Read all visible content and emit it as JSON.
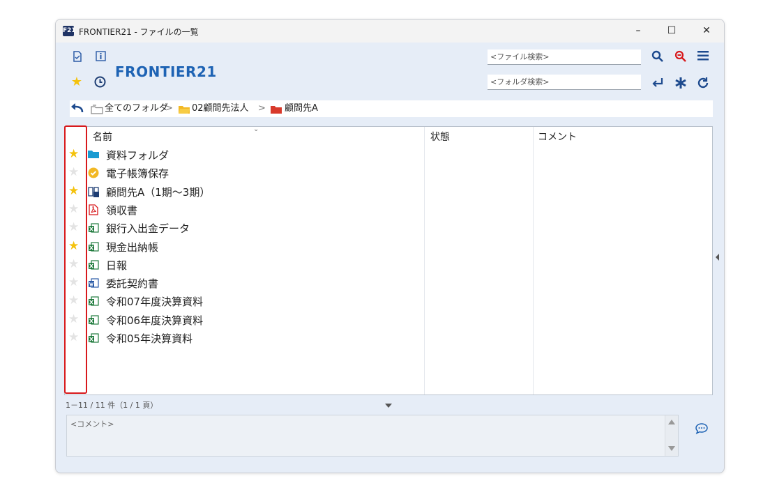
{
  "window": {
    "app_icon_text": "F21",
    "title": "FRONTIER21 - ファイルの一覧",
    "minimize_glyph": "–",
    "maximize_glyph": "☐",
    "close_glyph": "✕"
  },
  "toolbar": {
    "brand": "FRONTIER21",
    "file_search_placeholder": "<ファイル検索>",
    "folder_search_placeholder": "<フォルダ検索>"
  },
  "breadcrumb": {
    "items": [
      "全てのフォルダ",
      "02顧問先法人",
      "顧問先A"
    ],
    "separator": ">"
  },
  "columns": [
    "名前",
    "状態",
    "コメント"
  ],
  "files": [
    {
      "name": "資料フォルダ",
      "starred": true,
      "icon": "folder-icon"
    },
    {
      "name": "電子帳簿保存",
      "starred": false,
      "icon": "check-badge-icon"
    },
    {
      "name": "顧問先A（1期～3期）",
      "starred": true,
      "icon": "binder-icon"
    },
    {
      "name": "領収書",
      "starred": false,
      "icon": "pdf-icon"
    },
    {
      "name": "銀行入出金データ",
      "starred": false,
      "icon": "excel-icon"
    },
    {
      "name": "現金出納帳",
      "starred": true,
      "icon": "excel-icon"
    },
    {
      "name": "日報",
      "starred": false,
      "icon": "excel-icon"
    },
    {
      "name": "委託契約書",
      "starred": false,
      "icon": "word-icon"
    },
    {
      "name": "令和07年度決算資料",
      "starred": false,
      "icon": "excel-icon"
    },
    {
      "name": "令和06年度決算資料",
      "starred": false,
      "icon": "excel-icon"
    },
    {
      "name": "令和05年決算資料",
      "starred": false,
      "icon": "excel-icon"
    }
  ],
  "pager": "1－11 / 11 件（1 / 1 頁）",
  "comment_placeholder": "<コメント>",
  "colors": {
    "accent": "#1e63b4",
    "star_on": "#f4c20d",
    "star_off": "#e3e3e3",
    "highlight": "#d8191c",
    "window_bg": "#e6edf7"
  }
}
